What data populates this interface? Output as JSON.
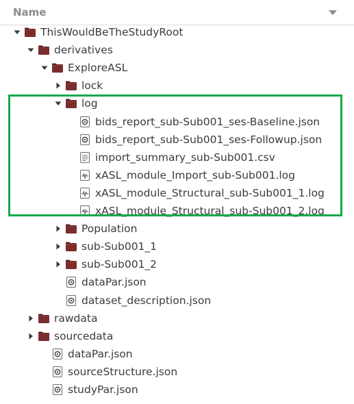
{
  "header": {
    "column_name": "Name"
  },
  "tree": [
    {
      "label": "ThisWouldBeTheStudyRoot",
      "type": "folder",
      "state": "expanded",
      "icon": "folder-icon"
    },
    {
      "label": "derivatives",
      "type": "folder",
      "state": "expanded",
      "icon": "folder-icon"
    },
    {
      "label": "ExploreASL",
      "type": "folder",
      "state": "expanded",
      "icon": "folder-icon"
    },
    {
      "label": "lock",
      "type": "folder",
      "state": "collapsed",
      "icon": "folder-icon"
    },
    {
      "label": "log",
      "type": "folder",
      "state": "expanded",
      "icon": "folder-icon"
    },
    {
      "label": "bids_report_sub-Sub001_ses-Baseline.json",
      "type": "file",
      "icon": "json-file-icon"
    },
    {
      "label": "bids_report_sub-Sub001_ses-Followup.json",
      "type": "file",
      "icon": "json-file-icon"
    },
    {
      "label": "import_summary_sub-Sub001.csv",
      "type": "file",
      "icon": "text-file-icon"
    },
    {
      "label": "xASL_module_Import_sub-Sub001.log",
      "type": "file",
      "icon": "log-file-icon"
    },
    {
      "label": "xASL_module_Structural_sub-Sub001_1.log",
      "type": "file",
      "icon": "log-file-icon"
    },
    {
      "label": "xASL_module_Structural_sub-Sub001_2.log",
      "type": "file",
      "icon": "log-file-icon"
    },
    {
      "label": "Population",
      "type": "folder",
      "state": "collapsed",
      "icon": "folder-icon"
    },
    {
      "label": "sub-Sub001_1",
      "type": "folder",
      "state": "collapsed",
      "icon": "folder-icon"
    },
    {
      "label": "sub-Sub001_2",
      "type": "folder",
      "state": "collapsed",
      "icon": "folder-icon"
    },
    {
      "label": "dataPar.json",
      "type": "file",
      "icon": "json-file-icon"
    },
    {
      "label": "dataset_description.json",
      "type": "file",
      "icon": "json-file-icon"
    },
    {
      "label": "rawdata",
      "type": "folder",
      "state": "collapsed",
      "icon": "folder-icon"
    },
    {
      "label": "sourcedata",
      "type": "folder",
      "state": "collapsed",
      "icon": "folder-icon"
    },
    {
      "label": "dataPar.json",
      "type": "file",
      "icon": "json-file-icon"
    },
    {
      "label": "sourceStructure.json",
      "type": "file",
      "icon": "json-file-icon"
    },
    {
      "label": "studyPar.json",
      "type": "file",
      "icon": "json-file-icon"
    }
  ],
  "colors": {
    "folder_body": "#7b2d2d",
    "folder_tab": "#5e1f1f",
    "highlight_border": "#17a84b",
    "header_text": "#8c8c8c"
  }
}
